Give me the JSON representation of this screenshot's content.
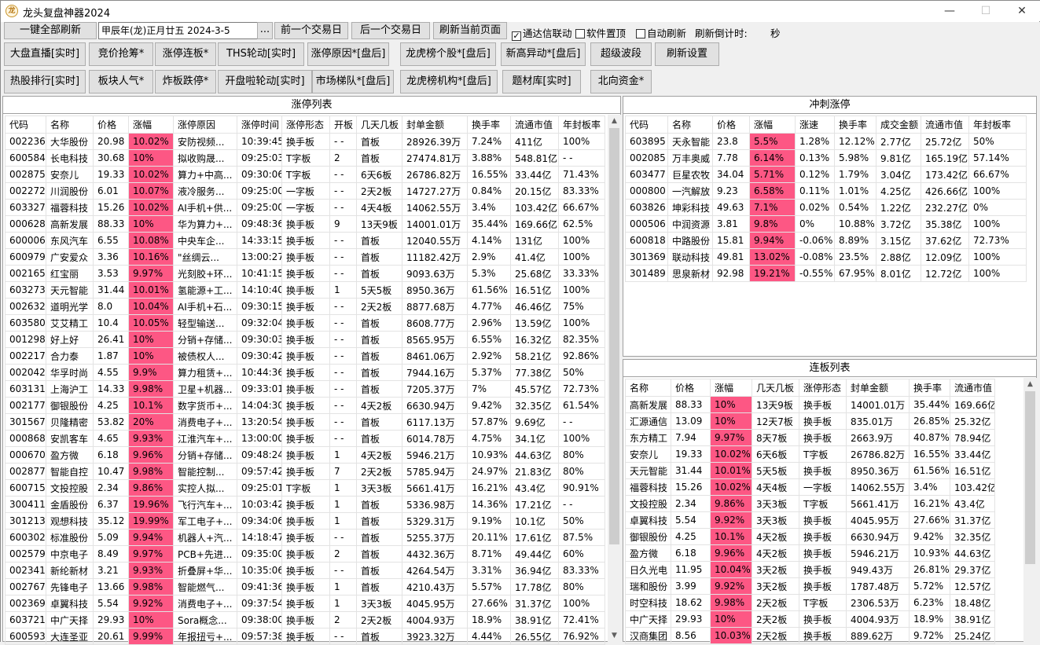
{
  "window": {
    "title": "龙头复盘神器2024",
    "icon_text": "龙",
    "min_glyph": "—",
    "max_glyph": "☐",
    "close_glyph": "✕"
  },
  "toolbar1": {
    "refresh_all": "一键全部刷新",
    "date_value": "甲辰年(龙)正月廿五  2024-3-5",
    "browse": "...",
    "prev_day": "前一个交易日",
    "next_day": "后一个交易日",
    "refresh_page": "刷新当前页面",
    "chk_tdx": "通达信联动",
    "chk_tdx_checked": true,
    "chk_top": "软件置顶",
    "chk_top_checked": false,
    "chk_auto": "自动刷新",
    "chk_auto_checked": false,
    "countdown_label": "刷新倒计时:",
    "countdown_unit": "秒"
  },
  "toolbar2": [
    "大盘直播[实时]",
    "竞价抢筹*",
    "涨停连板*",
    "THS轮动[实时]",
    "涨停原因*[盘后]",
    "龙虎榜个股*[盘后]",
    "新高异动*[盘后]",
    "超级波段",
    "刷新设置"
  ],
  "toolbar3": [
    "热股排行[实时]",
    "板块人气*",
    "炸板跌停*",
    "开盘啦轮动[实时]",
    "市场梯队*[盘后]",
    "龙虎榜机构*[盘后]",
    "题材库[实时]",
    "北向资金*"
  ],
  "limit_up": {
    "title": "涨停列表",
    "headers": [
      "代码",
      "名称",
      "价格",
      "涨幅",
      "涨停原因",
      "涨停时间",
      "涨停形态",
      "开板",
      "几天几板",
      "封单金额",
      "换手率",
      "流通市值",
      "年封板率"
    ],
    "rows": [
      [
        "002236",
        "大华股份",
        "20.98",
        "10.02%",
        "安防视频...",
        "10:39:45",
        "换手板",
        "- -",
        "首板",
        "28926.39万",
        "7.24%",
        "411亿",
        "100%"
      ],
      [
        "600584",
        "长电科技",
        "30.68",
        "10%",
        "拟收购晟...",
        "09:25:03",
        "T字板",
        "2",
        "首板",
        "27474.81万",
        "3.88%",
        "548.81亿",
        "- -"
      ],
      [
        "002875",
        "安奈儿",
        "19.33",
        "10.02%",
        "算力+中高...",
        "09:30:06",
        "T字板",
        "- -",
        "6天6板",
        "26786.82万",
        "16.55%",
        "33.44亿",
        "71.43%"
      ],
      [
        "002272",
        "川润股份",
        "6.01",
        "10.07%",
        "液冷服务...",
        "09:25:00",
        "一字板",
        "- -",
        "2天2板",
        "14727.27万",
        "0.84%",
        "20.15亿",
        "83.33%"
      ],
      [
        "603327",
        "福蓉科技",
        "15.26",
        "10.02%",
        "AI手机+供...",
        "09:25:00",
        "一字板",
        "- -",
        "4天4板",
        "14062.55万",
        "3.4%",
        "103.42亿",
        "66.67%"
      ],
      [
        "000628",
        "高新发展",
        "88.33",
        "10%",
        "华为算力+...",
        "09:48:36",
        "换手板",
        "9",
        "13天9板",
        "14001.01万",
        "35.44%",
        "169.66亿",
        "62.5%"
      ],
      [
        "600006",
        "东风汽车",
        "6.55",
        "10.08%",
        "中央车企...",
        "14:33:15",
        "换手板",
        "- -",
        "首板",
        "12040.55万",
        "4.14%",
        "131亿",
        "100%"
      ],
      [
        "600979",
        "广安爱众",
        "3.36",
        "10.16%",
        "\"丝绸云...",
        "13:00:27",
        "换手板",
        "- -",
        "首板",
        "11182.42万",
        "2.9%",
        "41.4亿",
        "100%"
      ],
      [
        "002165",
        "红宝丽",
        "3.53",
        "9.97%",
        "光刻胶+环...",
        "10:41:15",
        "换手板",
        "- -",
        "首板",
        "9093.63万",
        "5.3%",
        "25.68亿",
        "33.33%"
      ],
      [
        "603273",
        "天元智能",
        "31.44",
        "10.01%",
        "氢能源+工...",
        "14:10:40",
        "换手板",
        "1",
        "5天5板",
        "8950.36万",
        "61.56%",
        "16.51亿",
        "100%"
      ],
      [
        "002632",
        "道明光学",
        "8.0",
        "10.04%",
        "AI手机+石...",
        "09:30:15",
        "换手板",
        "- -",
        "2天2板",
        "8877.68万",
        "4.77%",
        "46.46亿",
        "75%"
      ],
      [
        "603580",
        "艾艾精工",
        "10.4",
        "10.05%",
        "轻型输送...",
        "09:32:04",
        "换手板",
        "- -",
        "首板",
        "8608.77万",
        "2.96%",
        "13.59亿",
        "100%"
      ],
      [
        "001298",
        "好上好",
        "26.41",
        "10%",
        "分销+存储...",
        "09:30:03",
        "换手板",
        "- -",
        "首板",
        "8565.95万",
        "6.55%",
        "16.32亿",
        "82.35%"
      ],
      [
        "002217",
        "合力泰",
        "1.87",
        "10%",
        "被债权人...",
        "09:30:42",
        "换手板",
        "- -",
        "首板",
        "8461.06万",
        "2.92%",
        "58.21亿",
        "92.86%"
      ],
      [
        "002042",
        "华孚时尚",
        "4.55",
        "9.9%",
        "算力租赁+...",
        "10:44:36",
        "换手板",
        "- -",
        "首板",
        "7944.16万",
        "5.37%",
        "77.38亿",
        "50%"
      ],
      [
        "603131",
        "上海沪工",
        "14.33",
        "9.98%",
        "卫星+机器...",
        "09:33:01",
        "换手板",
        "- -",
        "首板",
        "7205.37万",
        "7%",
        "45.57亿",
        "72.73%"
      ],
      [
        "002177",
        "御银股份",
        "4.25",
        "10.1%",
        "数字货币+...",
        "14:04:30",
        "换手板",
        "- -",
        "4天2板",
        "6630.94万",
        "9.42%",
        "32.35亿",
        "61.54%"
      ],
      [
        "301567",
        "贝隆精密",
        "53.82",
        "20%",
        "消费电子+...",
        "13:20:54",
        "换手板",
        "- -",
        "首板",
        "6117.13万",
        "57.87%",
        "9.69亿",
        "- -"
      ],
      [
        "000868",
        "安凯客车",
        "4.65",
        "9.93%",
        "江淮汽车+...",
        "13:00:00",
        "换手板",
        "- -",
        "首板",
        "6014.78万",
        "4.75%",
        "34.1亿",
        "100%"
      ],
      [
        "000670",
        "盈方微",
        "6.18",
        "9.96%",
        "分销+存储...",
        "09:48:24",
        "换手板",
        "1",
        "4天2板",
        "5946.21万",
        "10.93%",
        "44.63亿",
        "80%"
      ],
      [
        "002877",
        "智能自控",
        "10.47",
        "9.98%",
        "智能控制...",
        "09:57:42",
        "换手板",
        "7",
        "2天2板",
        "5785.94万",
        "24.97%",
        "21.83亿",
        "80%"
      ],
      [
        "600715",
        "文投控股",
        "2.34",
        "9.86%",
        "实控人拟...",
        "09:25:01",
        "T字板",
        "1",
        "3天3板",
        "5661.41万",
        "16.21%",
        "43.4亿",
        "90.91%"
      ],
      [
        "300411",
        "金盾股份",
        "6.37",
        "19.96%",
        "飞行汽车+...",
        "10:03:42",
        "换手板",
        "1",
        "首板",
        "5336.98万",
        "14.36%",
        "17.21亿",
        "- -"
      ],
      [
        "301213",
        "观想科技",
        "35.12",
        "19.99%",
        "军工电子+...",
        "09:34:06",
        "换手板",
        "1",
        "首板",
        "5329.31万",
        "9.19%",
        "10.1亿",
        "50%"
      ],
      [
        "600302",
        "标准股份",
        "5.09",
        "9.94%",
        "机器人+汽...",
        "14:18:47",
        "换手板",
        "- -",
        "首板",
        "5255.37万",
        "20.11%",
        "17.61亿",
        "87.5%"
      ],
      [
        "002579",
        "中京电子",
        "8.49",
        "9.97%",
        "PCB+先进...",
        "09:35:00",
        "换手板",
        "2",
        "首板",
        "4432.36万",
        "8.71%",
        "49.44亿",
        "60%"
      ],
      [
        "002341",
        "新纶新材",
        "3.21",
        "9.93%",
        "折叠屏+华...",
        "10:35:06",
        "换手板",
        "- -",
        "首板",
        "4264.54万",
        "3.31%",
        "36.94亿",
        "83.33%"
      ],
      [
        "002767",
        "先锋电子",
        "13.66",
        "9.98%",
        "智能燃气...",
        "09:41:36",
        "换手板",
        "1",
        "首板",
        "4210.43万",
        "5.57%",
        "17.78亿",
        "80%"
      ],
      [
        "002369",
        "卓翼科技",
        "5.54",
        "9.92%",
        "消费电子+...",
        "09:37:54",
        "换手板",
        "1",
        "3天3板",
        "4045.95万",
        "27.66%",
        "31.37亿",
        "100%"
      ],
      [
        "603721",
        "中广天择",
        "29.93",
        "10%",
        "Sora概念...",
        "09:38:00",
        "换手板",
        "2",
        "2天2板",
        "4004.93万",
        "18.9%",
        "38.91亿",
        "72.41%"
      ],
      [
        "600593",
        "大连圣亚",
        "20.61",
        "9.99%",
        "年报扭亏+...",
        "09:57:38",
        "换手板",
        "- -",
        "首板",
        "3923.32万",
        "4.44%",
        "26.55亿",
        "76.92%"
      ]
    ]
  },
  "sprint": {
    "title": "冲刺涨停",
    "headers": [
      "代码",
      "名称",
      "价格",
      "涨幅",
      "涨速",
      "换手率",
      "成交金额",
      "流通市值",
      "年封板率"
    ],
    "rows": [
      [
        "603895",
        "天永智能",
        "23.8",
        "5.5%",
        "1.28%",
        "12.12%",
        "2.77亿",
        "25.72亿",
        "50%"
      ],
      [
        "002085",
        "万丰奥威",
        "7.78",
        "6.14%",
        "0.13%",
        "5.98%",
        "9.81亿",
        "165.19亿",
        "57.14%"
      ],
      [
        "603477",
        "巨星农牧",
        "34.04",
        "5.71%",
        "0.12%",
        "1.79%",
        "3.04亿",
        "173.42亿",
        "66.67%"
      ],
      [
        "000800",
        "一汽解放",
        "9.23",
        "6.58%",
        "0.11%",
        "1.01%",
        "4.25亿",
        "426.66亿",
        "100%"
      ],
      [
        "603826",
        "坤彩科技",
        "49.63",
        "7.1%",
        "0.02%",
        "0.54%",
        "1.22亿",
        "232.27亿",
        "0%"
      ],
      [
        "000506",
        "中润资源",
        "3.81",
        "9.8%",
        "0%",
        "10.88%",
        "3.72亿",
        "35.38亿",
        "100%"
      ],
      [
        "600818",
        "中路股份",
        "15.81",
        "9.94%",
        "-0.06%",
        "8.89%",
        "3.15亿",
        "37.62亿",
        "72.73%"
      ],
      [
        "301369",
        "联动科技",
        "49.81",
        "13.02%",
        "-0.08%",
        "23.5%",
        "2.88亿",
        "12.09亿",
        "100%"
      ],
      [
        "301489",
        "思泉新材",
        "92.98",
        "19.21%",
        "-0.55%",
        "67.95%",
        "8.01亿",
        "12.72亿",
        "100%"
      ]
    ]
  },
  "consecutive": {
    "title": "连板列表",
    "headers": [
      "名称",
      "价格",
      "涨幅",
      "几天几板",
      "涨停形态",
      "封单金额",
      "换手率",
      "流通市值"
    ],
    "rows": [
      [
        "高新发展",
        "88.33",
        "10%",
        "13天9板",
        "换手板",
        "14001.01万",
        "35.44%",
        "169.66亿"
      ],
      [
        "汇源通信",
        "13.09",
        "10%",
        "12天7板",
        "换手板",
        "835.01万",
        "26.85%",
        "25.32亿"
      ],
      [
        "东方精工",
        "7.94",
        "9.97%",
        "8天7板",
        "换手板",
        "2663.9万",
        "40.87%",
        "78.94亿"
      ],
      [
        "安奈儿",
        "19.33",
        "10.02%",
        "6天6板",
        "T字板",
        "26786.82万",
        "16.55%",
        "33.44亿"
      ],
      [
        "天元智能",
        "31.44",
        "10.01%",
        "5天5板",
        "换手板",
        "8950.36万",
        "61.56%",
        "16.51亿"
      ],
      [
        "福蓉科技",
        "15.26",
        "10.02%",
        "4天4板",
        "一字板",
        "14062.55万",
        "3.4%",
        "103.42亿"
      ],
      [
        "文投控股",
        "2.34",
        "9.86%",
        "3天3板",
        "T字板",
        "5661.41万",
        "16.21%",
        "43.4亿"
      ],
      [
        "卓翼科技",
        "5.54",
        "9.92%",
        "3天3板",
        "换手板",
        "4045.95万",
        "27.66%",
        "31.37亿"
      ],
      [
        "御银股份",
        "4.25",
        "10.1%",
        "4天2板",
        "换手板",
        "6630.94万",
        "9.42%",
        "32.35亿"
      ],
      [
        "盈方微",
        "6.18",
        "9.96%",
        "4天2板",
        "换手板",
        "5946.21万",
        "10.93%",
        "44.63亿"
      ],
      [
        "日久光电",
        "11.95",
        "10.04%",
        "3天2板",
        "换手板",
        "949.43万",
        "26.81%",
        "29.37亿"
      ],
      [
        "瑞和股份",
        "3.99",
        "9.92%",
        "3天2板",
        "换手板",
        "1787.48万",
        "5.72%",
        "12.57亿"
      ],
      [
        "时空科技",
        "18.62",
        "9.98%",
        "2天2板",
        "T字板",
        "2306.53万",
        "6.23%",
        "18.48亿"
      ],
      [
        "中广天择",
        "29.93",
        "10%",
        "2天2板",
        "换手板",
        "4004.93万",
        "18.9%",
        "38.91亿"
      ],
      [
        "汉商集团",
        "8.56",
        "10.03%",
        "2天2板",
        "换手板",
        "889.62万",
        "9.72%",
        "25.24亿"
      ]
    ]
  },
  "highlight_color": "#fd5784"
}
